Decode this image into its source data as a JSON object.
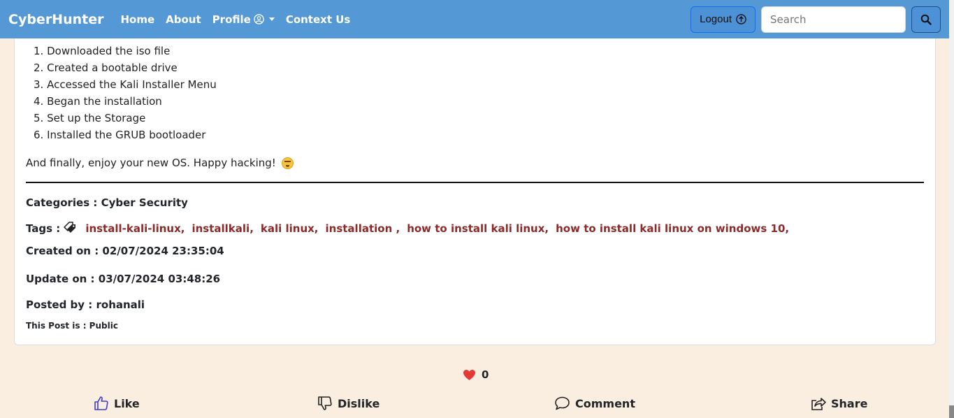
{
  "navbar": {
    "brand": "CyberHunter",
    "links": [
      "Home",
      "About",
      "Profile",
      "Context Us"
    ],
    "logout_label": "Logout",
    "search_placeholder": "Search"
  },
  "post": {
    "steps": [
      "Downloaded the iso file",
      "Created a bootable drive",
      "Accessed the Kali Installer Menu",
      "Began the installation",
      "Set up the Storage",
      "Installed the GRUB bootloader"
    ],
    "step_numbers": [
      "1.",
      "2.",
      "3.",
      "4.",
      "5.",
      "6."
    ],
    "closing_text": "And finally, enjoy your new OS. Happy hacking!",
    "categories": "Categories : Cyber Security",
    "tags_label": "Tags :",
    "tags": [
      "install-kali-linux,",
      "installkali,",
      "kali linux,",
      "installation ,",
      "how to install kali linux,",
      "how to install kali linux on windows 10,"
    ],
    "created": "Created on : 02/07/2024 23:35:04",
    "updated": "Update on : 03/07/2024 03:48:26",
    "posted_by": "Posted by : rohanali",
    "visibility": "This Post is : Public"
  },
  "reactions": {
    "likes_count": "0",
    "like_label": "Like",
    "dislike_label": "Dislike",
    "comment_label": "Comment",
    "share_label": "Share"
  },
  "colors": {
    "navbar": "#5499d6",
    "tag": "#8b2a2a",
    "heart": "#e53935",
    "like_icon": "#3b3bd4",
    "footer_bg": "#faeee0"
  }
}
